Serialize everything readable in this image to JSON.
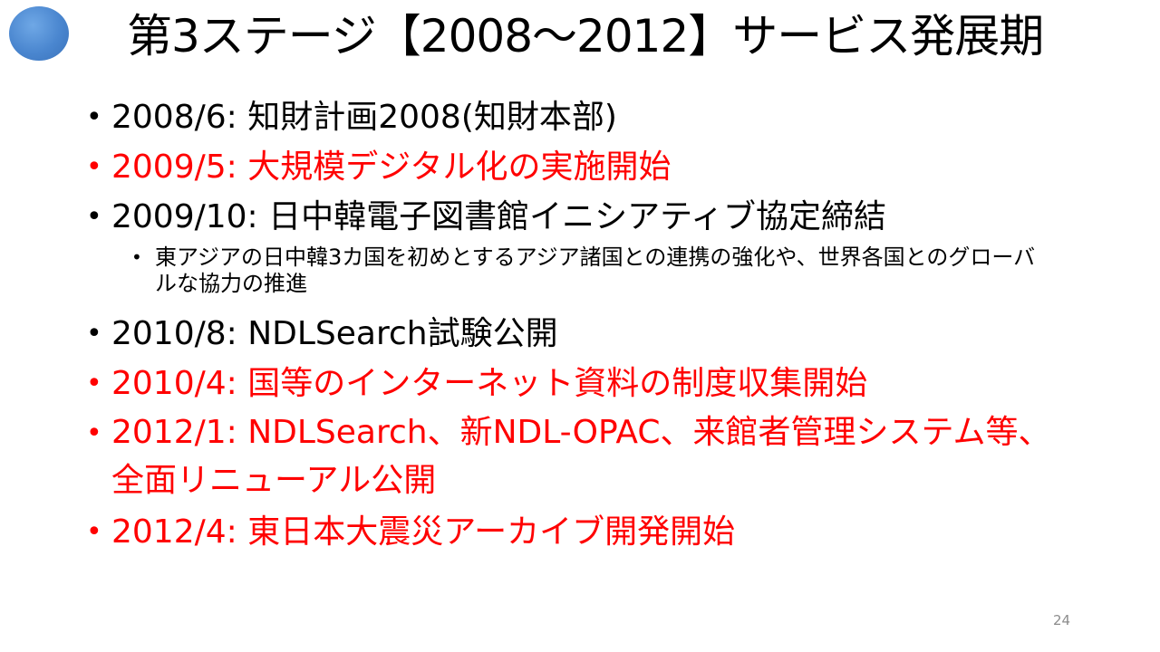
{
  "title": "第3ステージ【2008～2012】サービス発展期",
  "items": [
    {
      "text": "2008/6: 知財計画2008(知財本部)",
      "color": "#000000"
    },
    {
      "text": "2009/5: 大規模デジタル化の実施開始",
      "color": "#ff0000"
    },
    {
      "text": "2009/10: 日中韓電子図書館イニシアティブ協定締結",
      "color": "#000000",
      "subitem": "東アジアの日中韓3カ国を初めとするアジア諸国との連携の強化や、世界各国とのグローバルな協力の推進"
    },
    {
      "text": "2010/8: NDLSearch試験公開",
      "color": "#000000"
    },
    {
      "text": "2010/4: 国等のインターネット資料の制度収集開始",
      "color": "#ff0000"
    },
    {
      "text": "2012/1: NDLSearch、新NDL-OPAC、来館者管理システム等、全面リニューアル公開",
      "color": "#ff0000"
    },
    {
      "text": "2012/4: 東日本大震災アーカイブ開発開始",
      "color": "#ff0000"
    }
  ],
  "bullet_glyph": "•",
  "page_number": "24",
  "logo": {
    "shape": "circle",
    "color": "#4a86cf"
  }
}
